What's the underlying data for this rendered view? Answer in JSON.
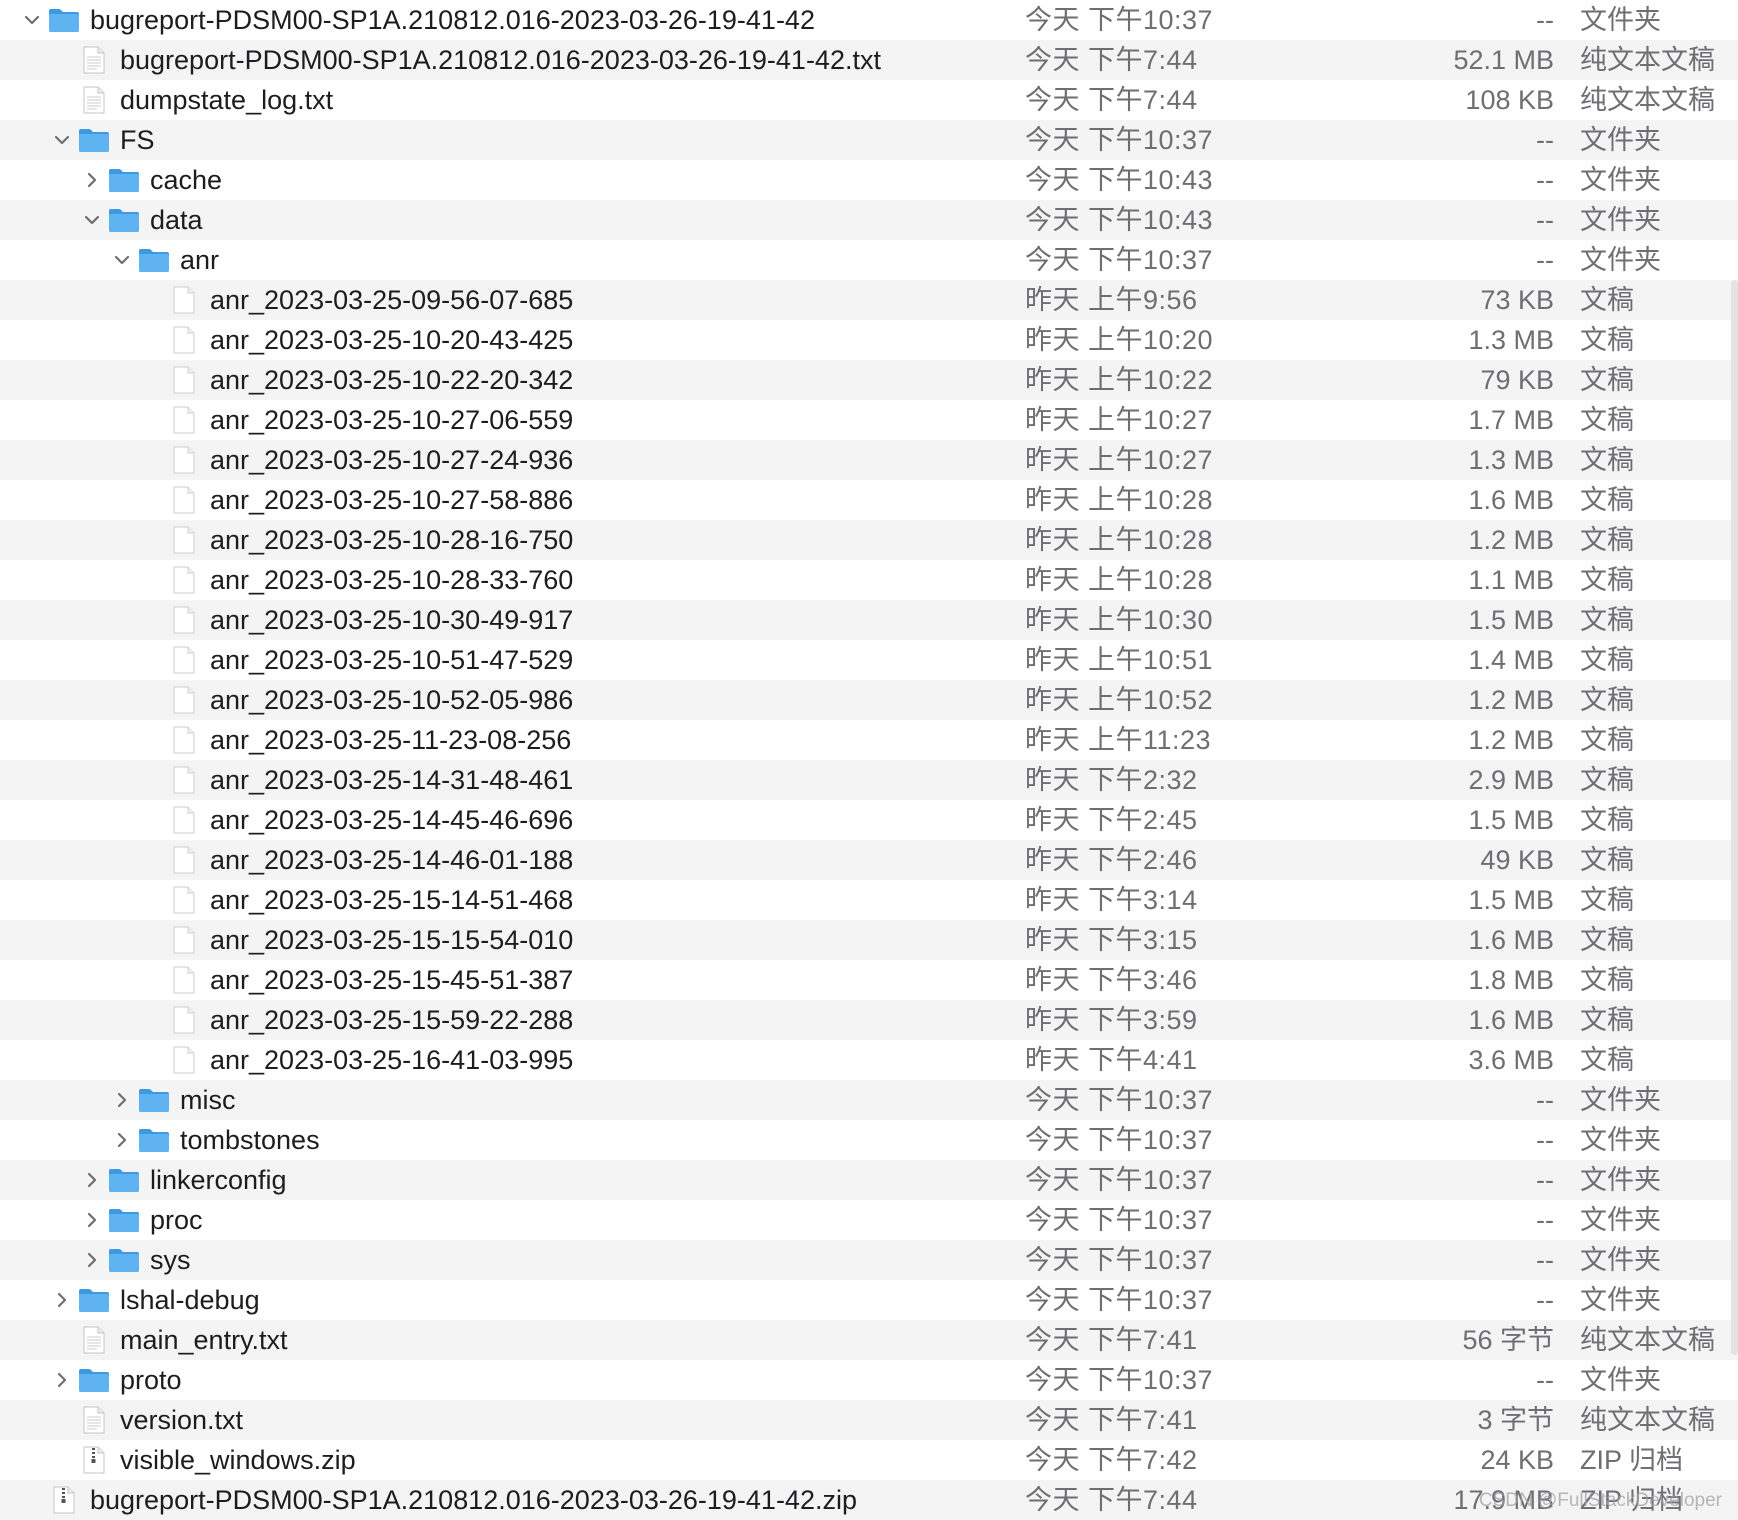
{
  "rows": [
    {
      "name": "bugreport-PDSM00-SP1A.210812.016-2023-03-26-19-41-42",
      "date": "今天 下午10:37",
      "size": "--",
      "kind": "文件夹",
      "type": "folder",
      "level": 0,
      "state": "expanded"
    },
    {
      "name": "bugreport-PDSM00-SP1A.210812.016-2023-03-26-19-41-42.txt",
      "date": "今天 下午7:44",
      "size": "52.1 MB",
      "kind": "纯文本文稿",
      "type": "text",
      "level": 1,
      "state": "none"
    },
    {
      "name": "dumpstate_log.txt",
      "date": "今天 下午7:44",
      "size": "108 KB",
      "kind": "纯文本文稿",
      "type": "text",
      "level": 1,
      "state": "none"
    },
    {
      "name": "FS",
      "date": "今天 下午10:37",
      "size": "--",
      "kind": "文件夹",
      "type": "folder",
      "level": 1,
      "state": "expanded"
    },
    {
      "name": "cache",
      "date": "今天 下午10:43",
      "size": "--",
      "kind": "文件夹",
      "type": "folder",
      "level": 2,
      "state": "collapsed"
    },
    {
      "name": "data",
      "date": "今天 下午10:43",
      "size": "--",
      "kind": "文件夹",
      "type": "folder",
      "level": 2,
      "state": "expanded"
    },
    {
      "name": "anr",
      "date": "今天 下午10:37",
      "size": "--",
      "kind": "文件夹",
      "type": "folder",
      "level": 3,
      "state": "expanded"
    },
    {
      "name": "anr_2023-03-25-09-56-07-685",
      "date": "昨天 上午9:56",
      "size": "73 KB",
      "kind": "文稿",
      "type": "doc",
      "level": 4,
      "state": "none"
    },
    {
      "name": "anr_2023-03-25-10-20-43-425",
      "date": "昨天 上午10:20",
      "size": "1.3 MB",
      "kind": "文稿",
      "type": "doc",
      "level": 4,
      "state": "none"
    },
    {
      "name": "anr_2023-03-25-10-22-20-342",
      "date": "昨天 上午10:22",
      "size": "79 KB",
      "kind": "文稿",
      "type": "doc",
      "level": 4,
      "state": "none"
    },
    {
      "name": "anr_2023-03-25-10-27-06-559",
      "date": "昨天 上午10:27",
      "size": "1.7 MB",
      "kind": "文稿",
      "type": "doc",
      "level": 4,
      "state": "none"
    },
    {
      "name": "anr_2023-03-25-10-27-24-936",
      "date": "昨天 上午10:27",
      "size": "1.3 MB",
      "kind": "文稿",
      "type": "doc",
      "level": 4,
      "state": "none"
    },
    {
      "name": "anr_2023-03-25-10-27-58-886",
      "date": "昨天 上午10:28",
      "size": "1.6 MB",
      "kind": "文稿",
      "type": "doc",
      "level": 4,
      "state": "none"
    },
    {
      "name": "anr_2023-03-25-10-28-16-750",
      "date": "昨天 上午10:28",
      "size": "1.2 MB",
      "kind": "文稿",
      "type": "doc",
      "level": 4,
      "state": "none"
    },
    {
      "name": "anr_2023-03-25-10-28-33-760",
      "date": "昨天 上午10:28",
      "size": "1.1 MB",
      "kind": "文稿",
      "type": "doc",
      "level": 4,
      "state": "none"
    },
    {
      "name": "anr_2023-03-25-10-30-49-917",
      "date": "昨天 上午10:30",
      "size": "1.5 MB",
      "kind": "文稿",
      "type": "doc",
      "level": 4,
      "state": "none"
    },
    {
      "name": "anr_2023-03-25-10-51-47-529",
      "date": "昨天 上午10:51",
      "size": "1.4 MB",
      "kind": "文稿",
      "type": "doc",
      "level": 4,
      "state": "none"
    },
    {
      "name": "anr_2023-03-25-10-52-05-986",
      "date": "昨天 上午10:52",
      "size": "1.2 MB",
      "kind": "文稿",
      "type": "doc",
      "level": 4,
      "state": "none"
    },
    {
      "name": "anr_2023-03-25-11-23-08-256",
      "date": "昨天 上午11:23",
      "size": "1.2 MB",
      "kind": "文稿",
      "type": "doc",
      "level": 4,
      "state": "none"
    },
    {
      "name": "anr_2023-03-25-14-31-48-461",
      "date": "昨天 下午2:32",
      "size": "2.9 MB",
      "kind": "文稿",
      "type": "doc",
      "level": 4,
      "state": "none"
    },
    {
      "name": "anr_2023-03-25-14-45-46-696",
      "date": "昨天 下午2:45",
      "size": "1.5 MB",
      "kind": "文稿",
      "type": "doc",
      "level": 4,
      "state": "none"
    },
    {
      "name": "anr_2023-03-25-14-46-01-188",
      "date": "昨天 下午2:46",
      "size": "49 KB",
      "kind": "文稿",
      "type": "doc",
      "level": 4,
      "state": "none"
    },
    {
      "name": "anr_2023-03-25-15-14-51-468",
      "date": "昨天 下午3:14",
      "size": "1.5 MB",
      "kind": "文稿",
      "type": "doc",
      "level": 4,
      "state": "none"
    },
    {
      "name": "anr_2023-03-25-15-15-54-010",
      "date": "昨天 下午3:15",
      "size": "1.6 MB",
      "kind": "文稿",
      "type": "doc",
      "level": 4,
      "state": "none"
    },
    {
      "name": "anr_2023-03-25-15-45-51-387",
      "date": "昨天 下午3:46",
      "size": "1.8 MB",
      "kind": "文稿",
      "type": "doc",
      "level": 4,
      "state": "none"
    },
    {
      "name": "anr_2023-03-25-15-59-22-288",
      "date": "昨天 下午3:59",
      "size": "1.6 MB",
      "kind": "文稿",
      "type": "doc",
      "level": 4,
      "state": "none"
    },
    {
      "name": "anr_2023-03-25-16-41-03-995",
      "date": "昨天 下午4:41",
      "size": "3.6 MB",
      "kind": "文稿",
      "type": "doc",
      "level": 4,
      "state": "none"
    },
    {
      "name": "misc",
      "date": "今天 下午10:37",
      "size": "--",
      "kind": "文件夹",
      "type": "folder",
      "level": 3,
      "state": "collapsed"
    },
    {
      "name": "tombstones",
      "date": "今天 下午10:37",
      "size": "--",
      "kind": "文件夹",
      "type": "folder",
      "level": 3,
      "state": "collapsed"
    },
    {
      "name": "linkerconfig",
      "date": "今天 下午10:37",
      "size": "--",
      "kind": "文件夹",
      "type": "folder",
      "level": 2,
      "state": "collapsed"
    },
    {
      "name": "proc",
      "date": "今天 下午10:37",
      "size": "--",
      "kind": "文件夹",
      "type": "folder",
      "level": 2,
      "state": "collapsed"
    },
    {
      "name": "sys",
      "date": "今天 下午10:37",
      "size": "--",
      "kind": "文件夹",
      "type": "folder",
      "level": 2,
      "state": "collapsed"
    },
    {
      "name": "lshal-debug",
      "date": "今天 下午10:37",
      "size": "--",
      "kind": "文件夹",
      "type": "folder",
      "level": 1,
      "state": "collapsed"
    },
    {
      "name": "main_entry.txt",
      "date": "今天 下午7:41",
      "size": "56 字节",
      "kind": "纯文本文稿",
      "type": "text",
      "level": 1,
      "state": "none"
    },
    {
      "name": "proto",
      "date": "今天 下午10:37",
      "size": "--",
      "kind": "文件夹",
      "type": "folder",
      "level": 1,
      "state": "collapsed"
    },
    {
      "name": "version.txt",
      "date": "今天 下午7:41",
      "size": "3 字节",
      "kind": "纯文本文稿",
      "type": "text",
      "level": 1,
      "state": "none"
    },
    {
      "name": "visible_windows.zip",
      "date": "今天 下午7:42",
      "size": "24 KB",
      "kind": "ZIP 归档",
      "type": "zip",
      "level": 1,
      "state": "none"
    },
    {
      "name": "bugreport-PDSM00-SP1A.210812.016-2023-03-26-19-41-42.zip",
      "date": "今天 下午7:44",
      "size": "17.9 MB",
      "kind": "ZIP 归档",
      "type": "zip",
      "level": 0,
      "state": "none"
    }
  ],
  "watermark": "CSDN @FullStackDeveloper",
  "colors": {
    "folder": "#5eb3f0",
    "folder_tab": "#3d9ae0",
    "row_alt": "#f4f4f5",
    "secondary_text": "#6e6e73"
  }
}
